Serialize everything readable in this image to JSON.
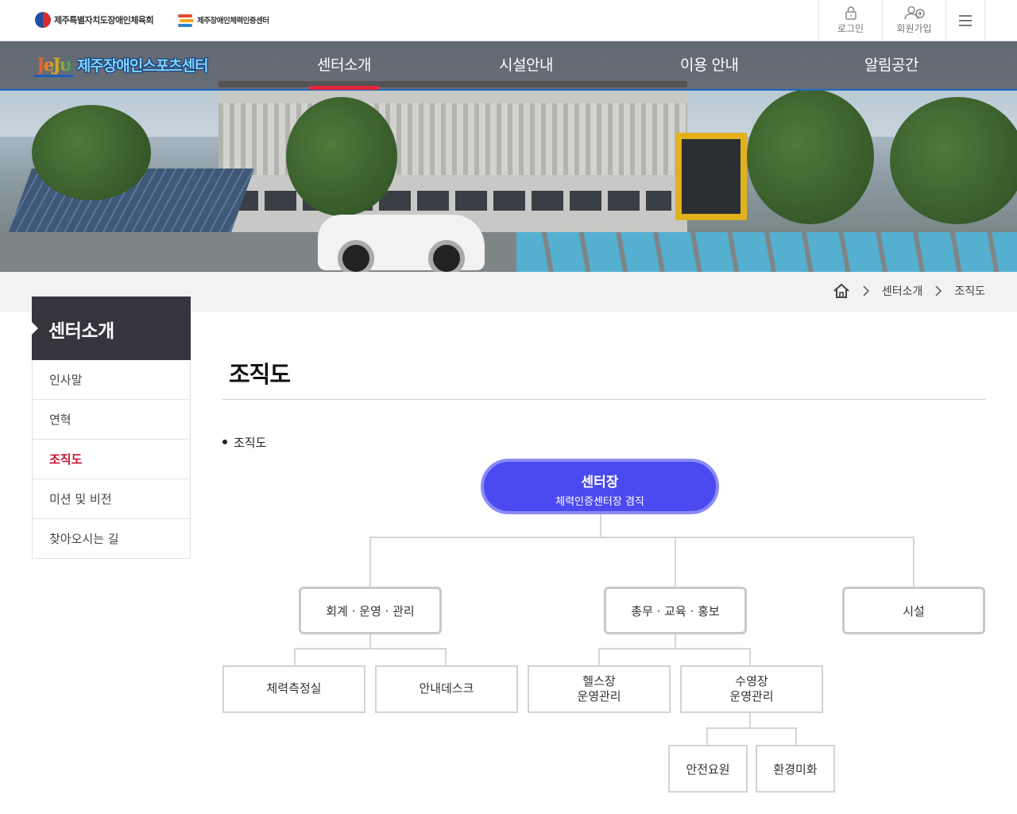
{
  "topbar": {
    "org1": "제주특별자치도장애인체육회",
    "org2": "제주장애인체력인증센터",
    "login": "로그인",
    "signup": "회원가입"
  },
  "nav": {
    "brand_mark": "JeJu",
    "brand_name": "제주장애인스포츠센터",
    "items": [
      "센터소개",
      "시설안내",
      "이용 안내",
      "알림공간"
    ],
    "active_index": 0
  },
  "breadcrumb": [
    "센터소개",
    "조직도"
  ],
  "sidebar": {
    "title": "센터소개",
    "items": [
      "인사말",
      "연혁",
      "조직도",
      "미션 및 비전",
      "찾아오시는 길"
    ],
    "active_index": 2
  },
  "page": {
    "title": "조직도",
    "section_label": "조직도"
  },
  "org": {
    "chief_title": "센터장",
    "chief_subtitle": "체력인증센터장 겸직",
    "departments": [
      "회계 · 운영 · 관리",
      "총무 · 교육 · 홍보",
      "시설"
    ],
    "units": [
      "체력측정실",
      "안내데스크",
      "헬스장\n운영관리",
      "수영장\n운영관리"
    ],
    "subunits": [
      "안전요원",
      "환경미화"
    ]
  },
  "colors": {
    "accent_red": "#c7122e",
    "chief_blue": "#4a4af0",
    "nav_underline": "#e2263b",
    "sidebar_head": "#35353d"
  }
}
